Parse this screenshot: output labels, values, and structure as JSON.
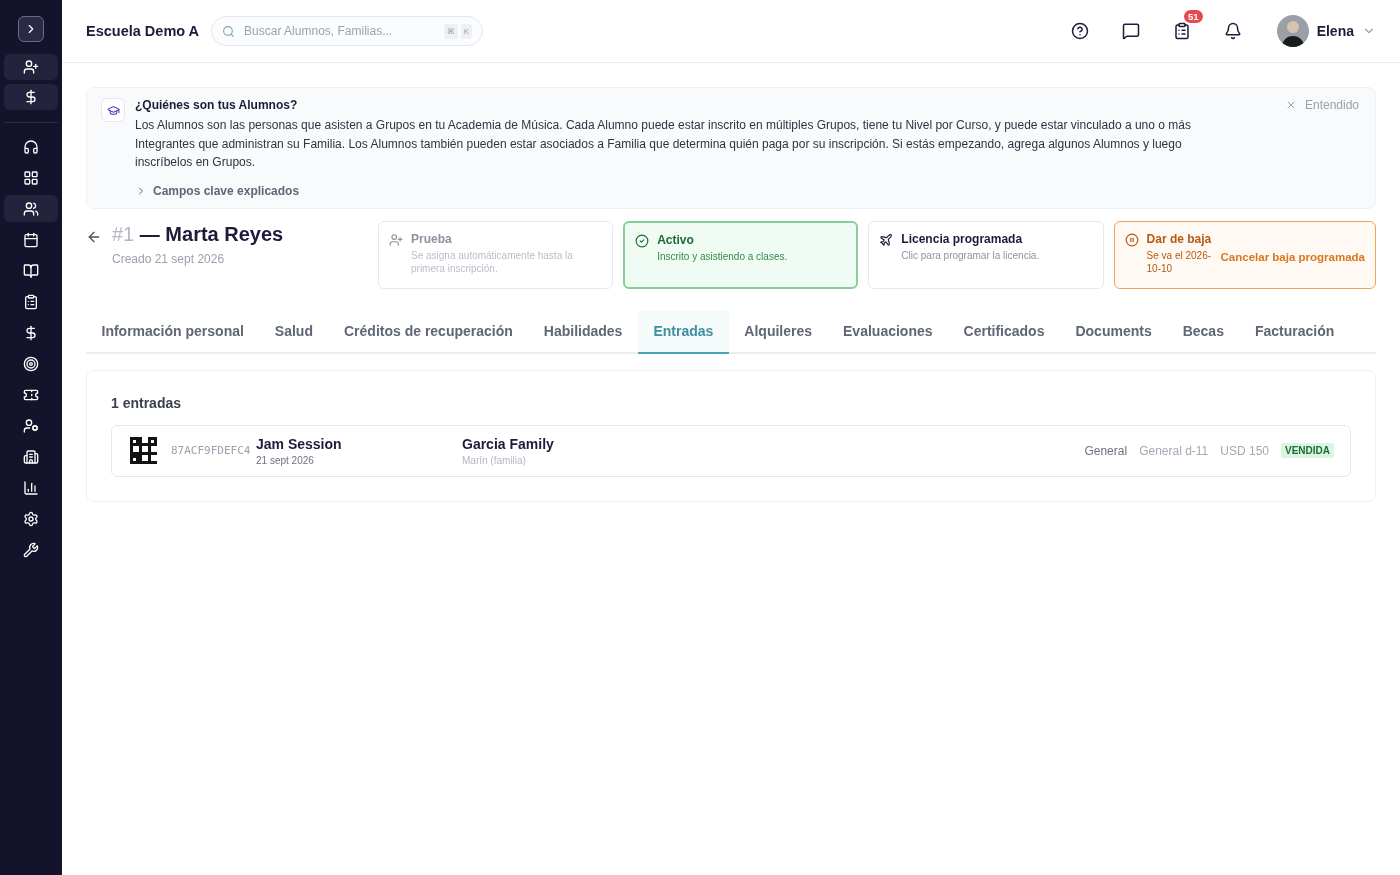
{
  "sidebar": {
    "items": [
      {
        "selected": false
      },
      {
        "selected": false
      },
      {
        "selected": true
      },
      {
        "selected": false
      },
      {
        "selected": false
      },
      {
        "selected": false
      },
      {
        "selected": false
      },
      {
        "selected": false
      },
      {
        "selected": false
      },
      {
        "selected": false
      },
      {
        "selected": false
      },
      {
        "selected": false
      },
      {
        "selected": false
      },
      {
        "selected": false
      }
    ]
  },
  "header": {
    "school": "Escuela Demo A",
    "search": {
      "placeholder": "Buscar Alumnos, Familias...",
      "keys": [
        "⌘",
        "K"
      ]
    },
    "tasks_badge": "51",
    "user": "Elena"
  },
  "info_banner": {
    "title": "¿Quiénes son tus Alumnos?",
    "text": "Los Alumnos son las personas que asisten a Grupos en tu Academia de Música. Cada Alumno puede estar inscrito en múltiples Grupos, tiene tu Nivel por Curso, y puede estar vinculado a uno o más Integrantes que administran su Familia. Los Alumnos también pueden estar asociados a Familia que determina quién paga por su inscripción. Si estás empezando, agrega algunos Alumnos y luego inscríbelos en Grupos.",
    "details": "Campos clave explicados",
    "expanded": false,
    "dismiss": "Entendido"
  },
  "student": {
    "number": "#1",
    "name": "— Marta Reyes",
    "created": "Creado 21 sept 2026"
  },
  "status_cards": [
    {
      "kind": "trial",
      "title": "Prueba",
      "description": "Se asigna automáticamente hasta la primera inscripción.",
      "selected": false
    },
    {
      "kind": "active",
      "title": "Activo",
      "description": "Inscrito y asistiendo a clases.",
      "selected": true
    },
    {
      "kind": "leave",
      "title": "Licencia programada",
      "description": "Clic para programar la licencia.",
      "selected": false
    },
    {
      "kind": "withdraw",
      "title": "Dar de baja",
      "description": "Se va el 2026-10-10",
      "action": "Cancelar baja programada",
      "selected": false
    }
  ],
  "tabs": [
    {
      "label": "Información personal",
      "selected": false
    },
    {
      "label": "Salud",
      "selected": false
    },
    {
      "label": "Créditos de recuperación",
      "selected": false
    },
    {
      "label": "Habilidades",
      "selected": false
    },
    {
      "label": "Entradas",
      "selected": true
    },
    {
      "label": "Alquileres",
      "selected": false
    },
    {
      "label": "Evaluaciones",
      "selected": false
    },
    {
      "label": "Certificados",
      "selected": false
    },
    {
      "label": "Documents",
      "selected": false
    },
    {
      "label": "Becas",
      "selected": false
    },
    {
      "label": "Facturación",
      "selected": false
    }
  ],
  "tickets": {
    "count": "1 entradas",
    "rows": [
      {
        "code": "87ACF9FDEFC4",
        "event": "Jam Session",
        "date": "21 sept 2026",
        "family": "Garcia Family",
        "family_note": "Marín (familia)",
        "type": "General",
        "seat": "General d-11",
        "price": "USD 150",
        "status": "VENDIDA"
      }
    ]
  }
}
